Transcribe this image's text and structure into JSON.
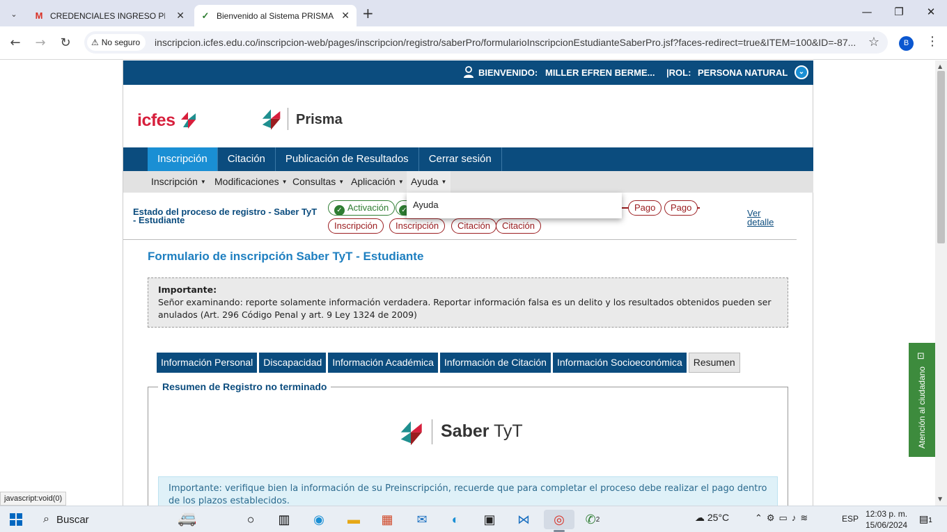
{
  "browser": {
    "tabs": [
      {
        "title": "CREDENCIALES INGRESO PRISMA",
        "icon": "gmail-icon"
      },
      {
        "title": "Bienvenido al Sistema PRISMA",
        "icon": "prisma-check-icon"
      }
    ],
    "security": "No seguro",
    "url": "inscripcion.icfes.edu.co/inscripcion-web/pages/inscripcion/registro/saberPro/formularioInscripcionEstudianteSaberPro.jsf?faces-redirect=true&ITEM=100&ID=-87...",
    "profile_initial": "B",
    "status_url": "javascript:void(0)"
  },
  "header": {
    "welcome_label": "BIENVENIDO:",
    "username": "MILLER EFREN BERME...",
    "rol_label": "|ROL:",
    "rol_value": "PERSONA NATURAL",
    "icfes_logo": "icfes",
    "prisma_title": "Prisma"
  },
  "main_nav": [
    "Inscripción",
    "Citación",
    "Publicación de Resultados",
    "Cerrar sesión"
  ],
  "sub_nav": [
    "Inscripción",
    "Modificaciones",
    "Consultas",
    "Aplicación",
    "Ayuda"
  ],
  "dropdown": {
    "item": "Ayuda"
  },
  "status": {
    "label": "Estado del proceso de registro - Saber TyT - Estudiante",
    "row1": [
      "Activación",
      "",
      "Pago",
      "Pago"
    ],
    "row2": [
      "Inscripción",
      "Inscripción",
      "Citación",
      "Citación"
    ],
    "ver_detalle": "Ver detalle"
  },
  "form": {
    "title": "Formulario de inscripción Saber TyT - Estudiante",
    "important_title": "Importante:",
    "important_text": "Señor examinando: reporte solamente información verdadera. Reportar información falsa es un delito y los resultados obtenidos pueden ser anulados (Art. 296 Código Penal y art. 9 Ley 1324 de 2009)",
    "tabs": [
      "Información Personal",
      "Discapacidad",
      "Información Académica",
      "Información de Citación",
      "Información Socioeconómica",
      "Resumen"
    ],
    "summary_legend": "Resumen de Registro no terminado",
    "saber_bold": "Saber",
    "saber_rest": "TyT",
    "info_text": "Importante: verifique bien la información de su Preinscripción, recuerde que para completar el proceso debe realizar el pago dentro de los plazos establecidos."
  },
  "chat_widget": "Atención al ciudadano",
  "taskbar": {
    "search": "Buscar",
    "temperature": "25°C",
    "language": "ESP",
    "time": "12:03 p. m.",
    "date": "15/06/2024",
    "whatsapp_badge": "2",
    "notif_badge": "1"
  },
  "colors": {
    "brand_blue": "#0b4c7e",
    "accent_blue": "#1a8fd4",
    "step_red": "#9b1d20",
    "step_green": "#2e7d32",
    "chat_green": "#3d8b3d"
  }
}
